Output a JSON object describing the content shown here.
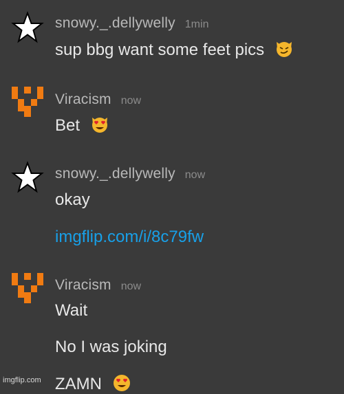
{
  "messages": [
    {
      "username": "snowy._.dellywelly",
      "time": "1min",
      "avatar": "star-icon",
      "lines": [
        {
          "text": "sup bbg want some feet pics",
          "emoji": "smirking-cat-emoji"
        }
      ]
    },
    {
      "username": "Viracism",
      "time": "now",
      "avatar": "orange-pixel-logo",
      "lines": [
        {
          "text": "Bet",
          "emoji": "heart-eyes-cat-emoji"
        }
      ]
    },
    {
      "username": "snowy._.dellywelly",
      "time": "now",
      "avatar": "star-icon",
      "lines": [
        {
          "text": "okay"
        },
        {
          "text": "imgflip.com/i/8c79fw",
          "link": true
        }
      ]
    },
    {
      "username": "Viracism",
      "time": "now",
      "avatar": "orange-pixel-logo",
      "lines": [
        {
          "text": "Wait"
        },
        {
          "text": "No I was joking"
        },
        {
          "text": "ZAMN",
          "emoji": "heart-eyes-emoji"
        }
      ]
    }
  ],
  "watermark": "imgflip.com",
  "colors": {
    "background": "#3a3a3a",
    "link": "#18a0e8",
    "avatar_orange": "#f07b12"
  }
}
